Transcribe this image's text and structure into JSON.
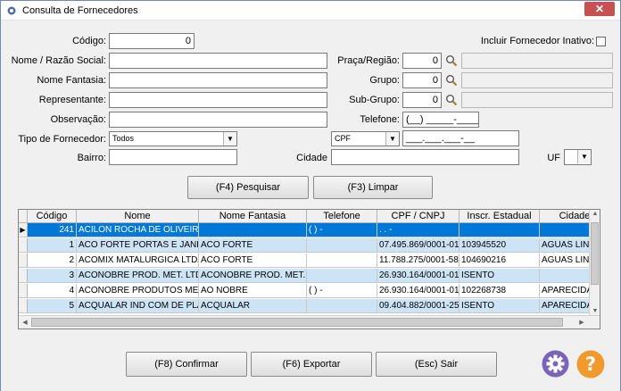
{
  "window": {
    "title": "Consulta de Fornecedores",
    "close_glyph": "✕"
  },
  "form": {
    "codigo": {
      "label": "Código:",
      "value": "0"
    },
    "incluir_inativo": {
      "label": "Incluir Fornecedor Inativo:",
      "checked": false
    },
    "nome": {
      "label": "Nome / Razão Social:",
      "value": ""
    },
    "praca": {
      "label": "Praça/Região:",
      "value": "0",
      "desc": ""
    },
    "fantasia": {
      "label": "Nome Fantasia:",
      "value": ""
    },
    "grupo": {
      "label": "Grupo:",
      "value": "0",
      "desc": ""
    },
    "representante": {
      "label": "Representante:",
      "value": ""
    },
    "subgrupo": {
      "label": "Sub-Grupo:",
      "value": "0",
      "desc": ""
    },
    "observacao": {
      "label": "Observação:",
      "value": ""
    },
    "telefone": {
      "label": "Telefone:",
      "value": "(__) _____-____"
    },
    "tipo": {
      "label": "Tipo de Fornecedor:",
      "value": "Todos"
    },
    "doc_tipo": {
      "value": "CPF"
    },
    "doc_num": {
      "value": "___.___.___-__"
    },
    "bairro": {
      "label": "Bairro:",
      "value": ""
    },
    "cidade": {
      "label": "Cidade",
      "value": ""
    },
    "uf": {
      "label": "UF",
      "value": ""
    }
  },
  "buttons": {
    "pesquisar": "(F4) Pesquisar",
    "limpar": "(F3) Limpar",
    "confirmar": "(F8) Confirmar",
    "exportar": "(F6) Exportar",
    "sair": "(Esc) Sair"
  },
  "icons": {
    "search": "magnifier-icon",
    "settings": "gear-icon",
    "help": "help-icon"
  },
  "colors": {
    "selected_row": "#0078d7",
    "alt_row": "#cde4f7",
    "help": "#f09a2e",
    "settings": "#7b63b8"
  },
  "grid": {
    "columns": [
      "Código",
      "Nome",
      "Nome Fantasia",
      "Telefone",
      "CPF / CNPJ",
      "Inscr. Estadual",
      "Cidade"
    ],
    "rows": [
      [
        "241",
        "ACILON ROCHA DE OLIVEIRA",
        "",
        "",
        ".   .   -",
        "",
        ""
      ],
      [
        "1",
        "ACO FORTE PORTAS E JANELAS",
        "ACO FORTE",
        "",
        "07.495.869/0001-01",
        "103945520",
        "AGUAS LINDAS DE GOIAS"
      ],
      [
        "2",
        "ACOMIX MATALURGICA LTDA ME",
        "ACO FORTE",
        "",
        "11.788.275/0001-58",
        "104690216",
        "AGUAS LINDAS DE GOIAS"
      ],
      [
        "3",
        "ACONOBRE PROD. MET. LTDA",
        "ACONOBRE PROD. MET. LTDA",
        "",
        "26.930.164/0001-01",
        "ISENTO",
        ""
      ],
      [
        "4",
        "ACONOBRE PRODUTOS METALURGICOS",
        "AO NOBRE",
        "( )    -",
        "26.930.164/0001-01",
        "102268738",
        "APARECIDA DE GOIANIA"
      ],
      [
        "5",
        "ACQUALAR IND COM DE PLASTICOS",
        "ACQUALAR",
        "",
        "09.404.882/0001-25",
        "ISENTO",
        "APARECIDA DE GOIANIA"
      ]
    ],
    "row0_phone": "( )    -"
  }
}
